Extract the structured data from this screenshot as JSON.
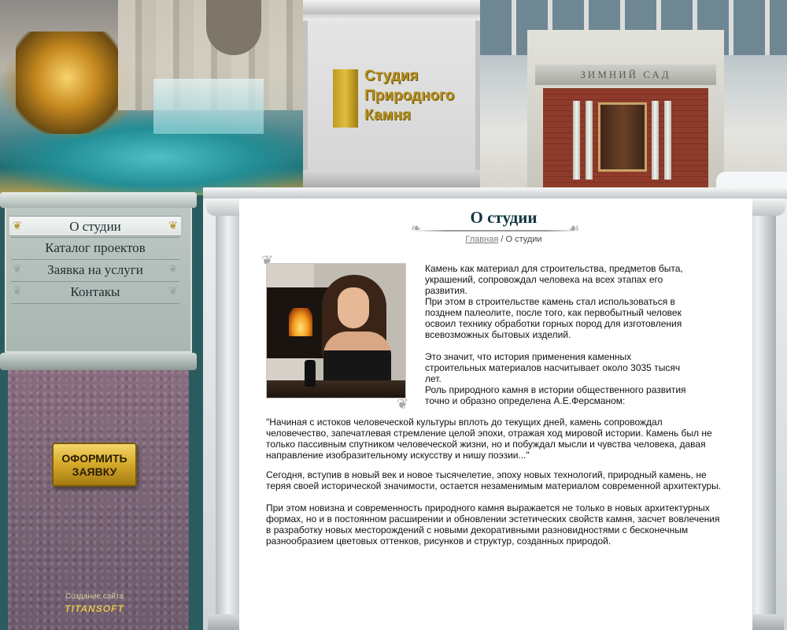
{
  "header": {
    "logo_line1": "Студия",
    "logo_line2": "Природного",
    "logo_line3": "Камня",
    "building_sign": "ЗИМНИЙ САД"
  },
  "menu": {
    "items": [
      {
        "label": "О студии",
        "active": true
      },
      {
        "label": "Каталог проектов",
        "active": false
      },
      {
        "label": "Заявка на услуги",
        "active": false
      },
      {
        "label": "Контакы",
        "active": false
      }
    ]
  },
  "order_button": {
    "line1": "ОФОРМИТЬ",
    "line2": "ЗАЯВКУ"
  },
  "credit": {
    "text": "Создание сайта",
    "logo": "TITANSOFT"
  },
  "page": {
    "title": "О студии",
    "breadcrumb_home": "Главная",
    "breadcrumb_sep": " / ",
    "breadcrumb_current": "О студии"
  },
  "content": {
    "side_p1": "Камень как материал для строительства, предметов быта, украшений, сопровождал человека на всех этапах его развития.",
    "side_p2": "При этом в строительстве камень стал использоваться в позднем палеолите, после того, как первобытный человек освоил технику обработки горных пород для изготовления всевозможных бытовых изделий.",
    "side_p3": "Это значит, что история применения каменных строительных материалов насчитывает около 3035 тысяч лет.",
    "side_p4": "Роль природного камня в истории общественного развития точно и образно определена А.Е.Ферсманом:",
    "quote": "\"Начиная с истоков человеческой культуры вплоть до текущих дней, камень сопровождал человечество, запечатлевая стремление целой эпохи, отражая ход мировой истории. Камень был не только пассивным спутником человеческой жизни, но и побуждал мысли и чувства человека, давая направление изобразительному искусству и нишу поэзии...\"",
    "p_modern": "Сегодня, вступив в новый век и новое тысячелетие, эпоху новых технологий, природный камень, не теряя своей исторической значимости, остается незаменимым материалом современной архитектуры.",
    "p_novelty": "При этом новизна и современность природного камня выражается не только в новых архитектурных формах, но и в постоянном расширении и обновлении эстетических свойств камня, засчет вовлечения в разработку новых месторождений с новыми декоративными разновидностями с бесконечным разнообразием цветовых оттенков, рисунков и структур, созданных природой."
  },
  "colors": {
    "gold": "#b48e1c",
    "title": "#123542",
    "sidebar_teal": "#2a5b5f",
    "granite": "#7a6476"
  }
}
